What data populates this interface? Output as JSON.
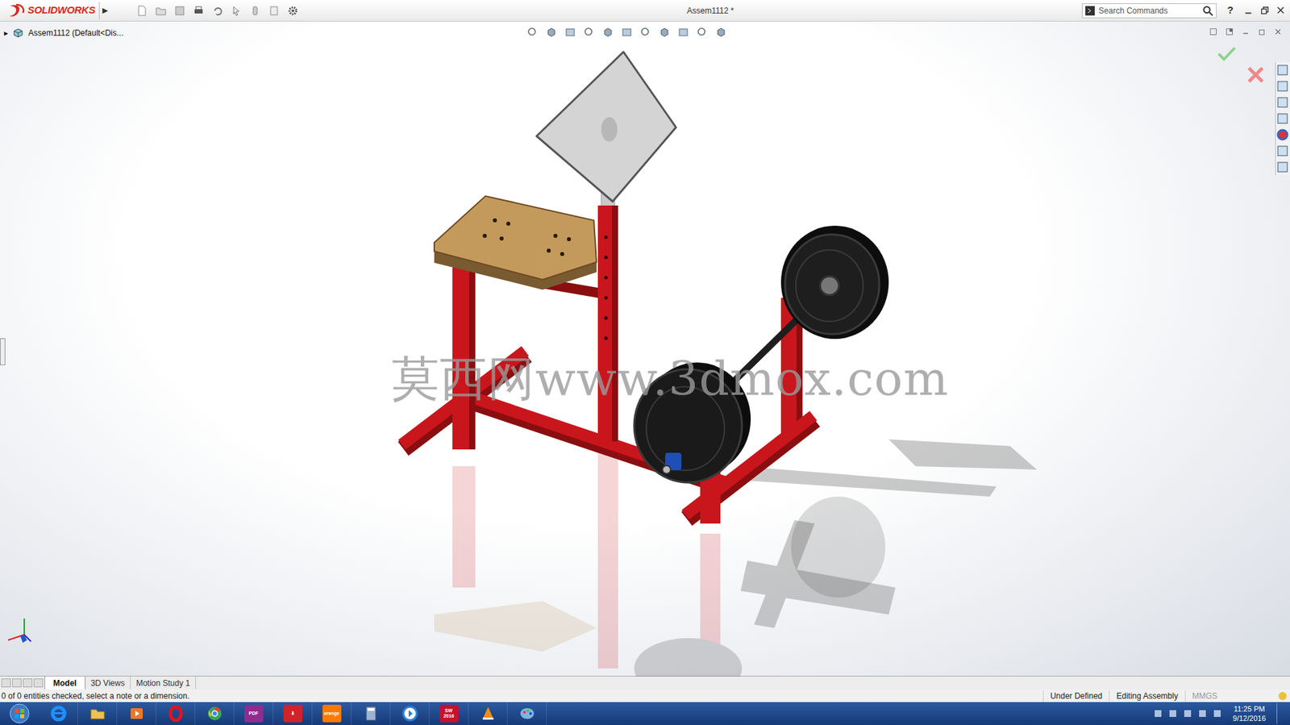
{
  "window": {
    "title": "Assem1112 *",
    "logo": "SOLIDWORKS",
    "flyout": "▶"
  },
  "search": {
    "placeholder": "Search Commands"
  },
  "help": "?",
  "tree": {
    "arrow": "▸",
    "root": "Assem1112  (Default<Dis...",
    "expanded": false
  },
  "watermark": "莫西网www.3dmox.com",
  "tabs": [
    {
      "label": "Model",
      "selected": true
    },
    {
      "label": "3D Views",
      "selected": false
    },
    {
      "label": "Motion Study 1",
      "selected": false
    }
  ],
  "status_bar": {
    "message": "0 of 0 entities checked, select a note or a dimension.",
    "fields": [
      {
        "text": "Under Defined",
        "dimmed": false
      },
      {
        "text": "Editing Assembly",
        "dimmed": false
      },
      {
        "text": "MMGS",
        "dimmed": true
      }
    ]
  },
  "taskbar": {
    "apps": [
      {
        "kind": "ie",
        "label": "",
        "color": "#1e90ff"
      },
      {
        "kind": "folder",
        "label": "",
        "color": "#e8c25a"
      },
      {
        "kind": "media",
        "label": "",
        "color": "#e57a2c"
      },
      {
        "kind": "opera",
        "label": "",
        "color": "#e0151f"
      },
      {
        "kind": "chrome",
        "label": "",
        "color": "#3aa655"
      },
      {
        "kind": "tile",
        "label": "PDF",
        "color": "#8e2d8f"
      },
      {
        "kind": "tile",
        "label": "⬇",
        "color": "#d2232a"
      },
      {
        "kind": "tile",
        "label": "orange",
        "color": "#ff7900"
      },
      {
        "kind": "calc",
        "label": "",
        "color": "#9db3d6"
      },
      {
        "kind": "player",
        "label": "",
        "color": "#2a7fd4"
      },
      {
        "kind": "tile",
        "label": "SW 2016",
        "color": "#c8102e"
      },
      {
        "kind": "vlc",
        "label": "",
        "color": "#f28c18"
      },
      {
        "kind": "paint",
        "label": "",
        "color": "#7fb6e0"
      }
    ],
    "time": "11:25 PM",
    "date": "9/12/2016"
  }
}
